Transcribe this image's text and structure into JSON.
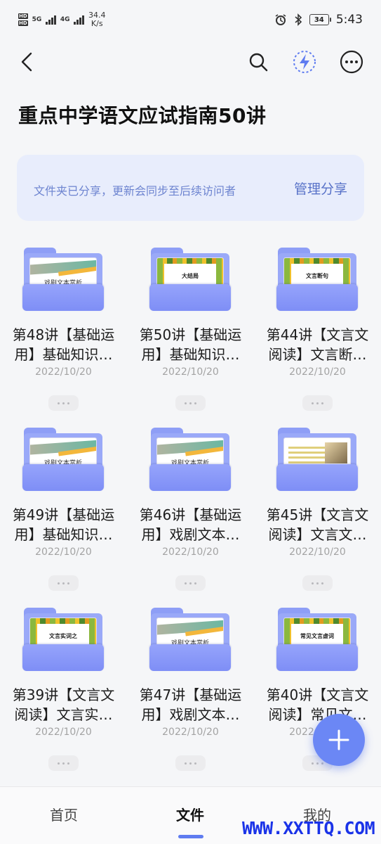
{
  "status_bar": {
    "net_left": "5G",
    "net_right": "4G",
    "speed_value": "34.4",
    "speed_unit": "K/s",
    "battery": "34",
    "time": "5:43"
  },
  "page": {
    "title": "重点中学语文应试指南50讲"
  },
  "share_banner": {
    "text": "文件夹已分享，更新会同步至后续访问者",
    "action": "管理分享"
  },
  "folders": [
    {
      "line1": "第48讲【基础运",
      "line2": "用】基础知识…",
      "date": "2022/10/20",
      "thumb": "wave",
      "thumb_text": "戏剧文本赏析"
    },
    {
      "line1": "第50讲【基础运",
      "line2": "用】基础知识…",
      "date": "2022/10/20",
      "thumb": "green",
      "thumb_text": "大结局"
    },
    {
      "line1": "第44讲【文言文",
      "line2": "阅读】文言断…",
      "date": "2022/10/20",
      "thumb": "green",
      "thumb_text": "文言断句"
    },
    {
      "line1": "第49讲【基础运",
      "line2": "用】基础知识…",
      "date": "2022/10/20",
      "thumb": "wave",
      "thumb_text": "戏剧文本赏析"
    },
    {
      "line1": "第46讲【基础运",
      "line2": "用】戏剧文本…",
      "date": "2022/10/20",
      "thumb": "wave",
      "thumb_text": "戏剧文本赏析"
    },
    {
      "line1": "第45讲【文言文",
      "line2": "阅读】文言文…",
      "date": "2022/10/20",
      "thumb": "dark",
      "thumb_text": ""
    },
    {
      "line1": "第39讲【文言文",
      "line2": "阅读】文言实…",
      "date": "2022/10/20",
      "thumb": "green",
      "thumb_text": "文言实词之"
    },
    {
      "line1": "第47讲【基础运",
      "line2": "用】戏剧文本…",
      "date": "2022/10/20",
      "thumb": "wave",
      "thumb_text": "戏剧文本赏析"
    },
    {
      "line1": "第40讲【文言文",
      "line2": "阅读】常见文…",
      "date": "2022/10/20",
      "thumb": "green",
      "thumb_text": "常见文言虚词"
    }
  ],
  "tabs": [
    {
      "label": "首页"
    },
    {
      "label": "文件"
    },
    {
      "label": "我的"
    }
  ],
  "watermark": "WWW.XXTTQ.COM",
  "colors": {
    "accent": "#5f7cf0",
    "banner": "#e8edfc",
    "folder": "#8e9ef6"
  }
}
